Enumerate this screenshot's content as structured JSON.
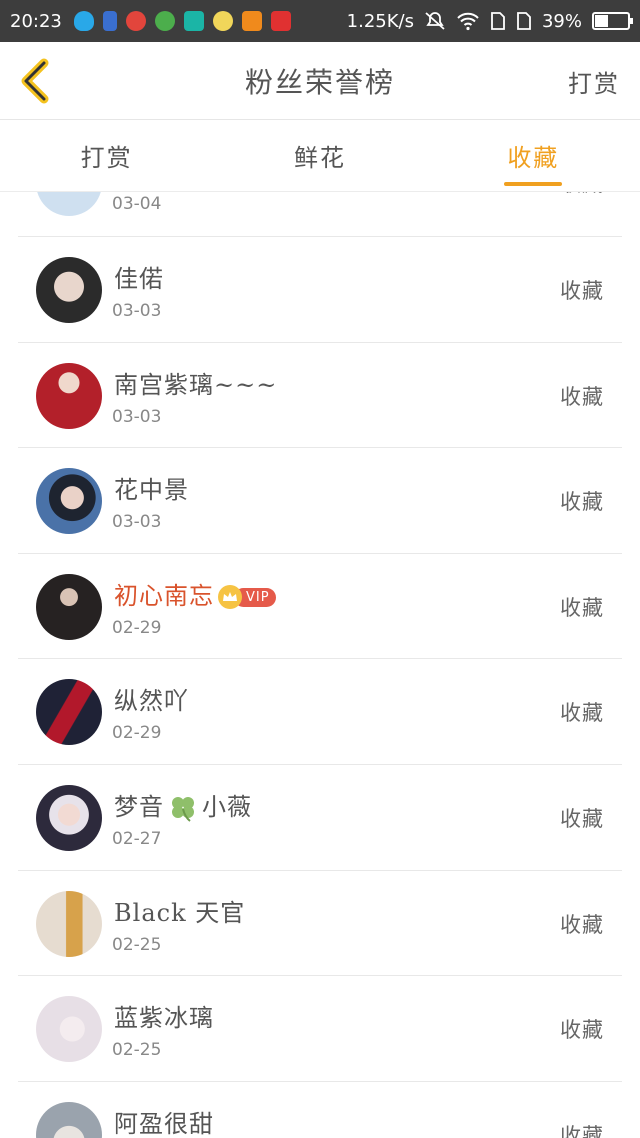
{
  "status_bar": {
    "time": "20:23",
    "network_speed": "1.25K/s",
    "battery": "39%",
    "battery_level": 0.39
  },
  "header": {
    "title": "粉丝荣誉榜",
    "action": "打赏"
  },
  "tabs": [
    {
      "label": "打赏",
      "active": false
    },
    {
      "label": "鲜花",
      "active": false
    },
    {
      "label": "收藏",
      "active": true
    }
  ],
  "accent_color": "#f0a020",
  "vip_label": "VIP",
  "list": [
    {
      "name": "",
      "date": "03-04",
      "action": "收藏",
      "avatar_color": "#cfe0f0"
    },
    {
      "name": "佳偌",
      "date": "03-03",
      "action": "收藏",
      "avatar_color": "#2b2b2b"
    },
    {
      "name": "南宫紫璃~~~",
      "date": "03-03",
      "action": "收藏",
      "avatar_color": "#b3202a"
    },
    {
      "name": "花中景",
      "date": "03-03",
      "action": "收藏",
      "avatar_color": "#3a5a80"
    },
    {
      "name": "初心南忘",
      "date": "02-29",
      "action": "收藏",
      "avatar_color": "#262222",
      "vip": true
    },
    {
      "name": "纵然吖",
      "date": "02-29",
      "action": "收藏",
      "avatar_color": "#1f2236"
    },
    {
      "name_a": "梦音",
      "name_b": "小薇",
      "date": "02-27",
      "action": "收藏",
      "avatar_color": "#2d2a3c"
    },
    {
      "name": "Black 天官",
      "date": "02-25",
      "action": "收藏",
      "avatar_color": "#c9b29a"
    },
    {
      "name": "蓝紫冰璃",
      "date": "02-25",
      "action": "收藏",
      "avatar_color": "#e7dfe6"
    },
    {
      "name": "阿盈很甜",
      "date": "",
      "action": "收藏",
      "avatar_color": "#9aa3ad"
    }
  ]
}
